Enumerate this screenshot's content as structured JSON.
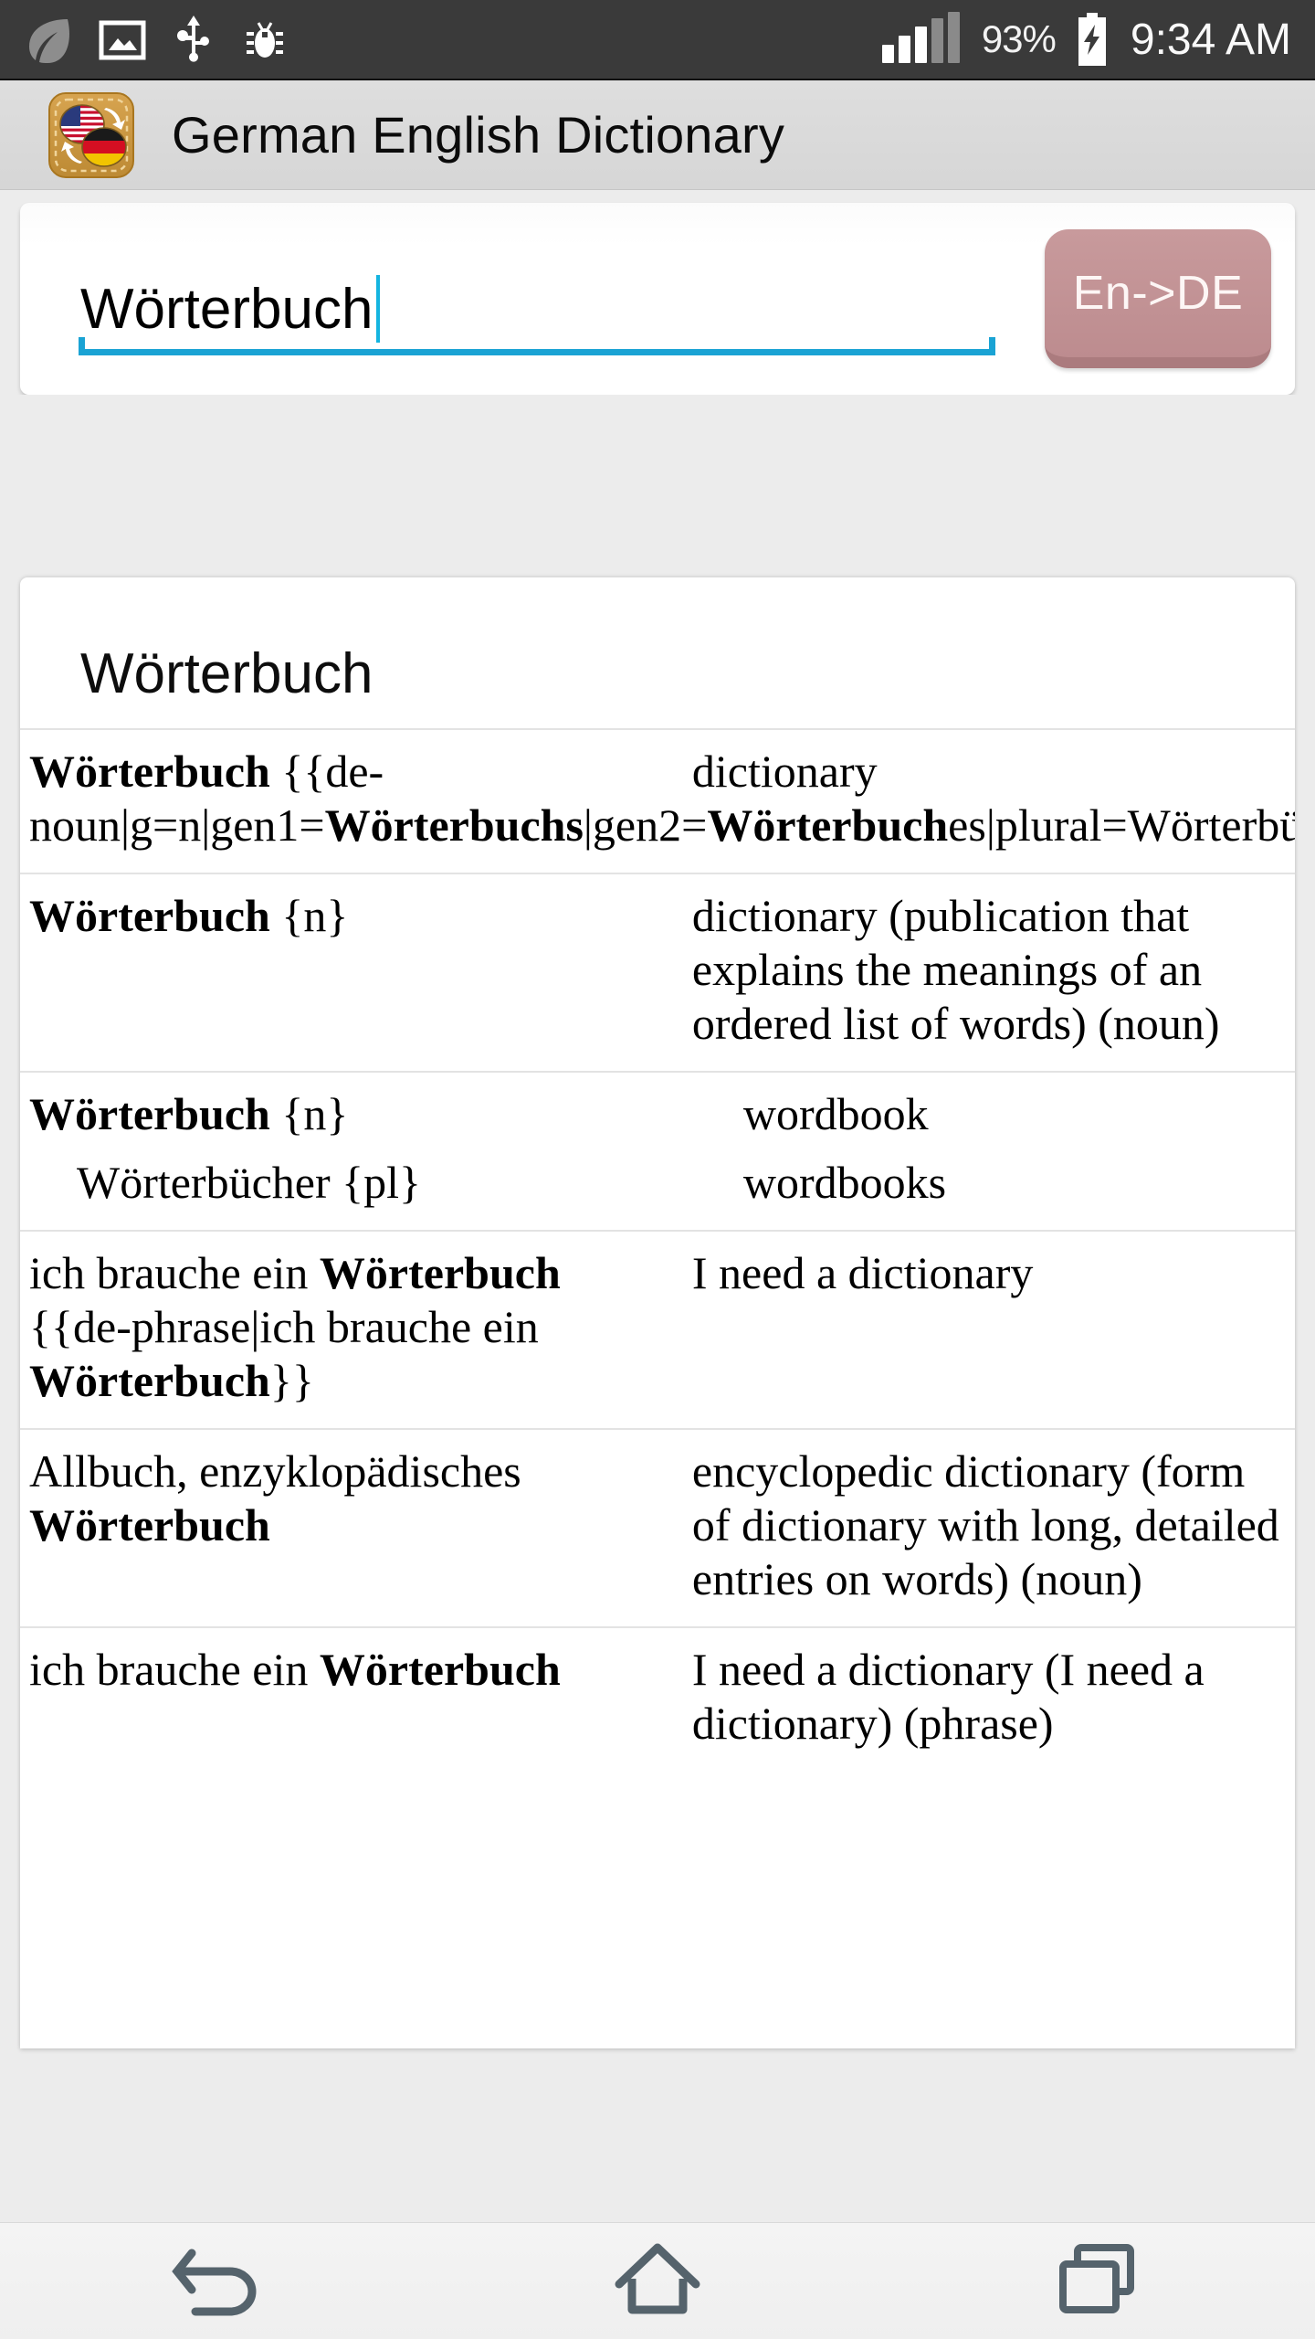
{
  "statusbar": {
    "icons": [
      "leaf-icon",
      "screenshot-icon",
      "usb-icon",
      "adb-bug-icon"
    ],
    "battery_percent": "93%",
    "battery_state": "charging",
    "signal_bars_active": 3,
    "signal_bars_total": 5,
    "clock": "9:34 AM"
  },
  "appbar": {
    "icon": "german-english-dictionary-app-icon",
    "title": "German English Dictionary"
  },
  "search": {
    "value": "Wörterbuch",
    "placeholder": "",
    "direction_button": "En->DE"
  },
  "results": {
    "heading": "Wörterbuch",
    "rows": [
      {
        "left_html": "<b>Wörterbuch</b> {{de-noun|g=n|gen1=<b>Wörterbuchs</b>|gen2=<b>Wörterbuch</b>es|plural=Wörterbücher}}",
        "left_text": "Wörterbuch {{de-noun|g=n|gen1=Wörterbuchs|gen2=Wörterbuches|plural=Wörterbücher}}",
        "right_html": "dictionary",
        "right_text": "dictionary",
        "right_indent": false,
        "sub_left_html": "",
        "sub_right_html": ""
      },
      {
        "left_html": "<b>Wörterbuch</b> {n}",
        "left_text": "Wörterbuch {n}",
        "right_html": "dictionary (publication that explains the meanings of an ordered list of words) (noun)",
        "right_text": "dictionary (publication that explains the meanings of an ordered list of words) (noun)",
        "right_indent": false,
        "sub_left_html": "",
        "sub_right_html": ""
      },
      {
        "left_html": "<b>Wörterbuch</b> {n}",
        "left_text": "Wörterbuch {n}",
        "right_html": "wordbook",
        "right_text": "wordbook",
        "right_indent": true,
        "sub_left_html": "Wörterbücher {pl}",
        "sub_right_html": "wordbooks"
      },
      {
        "left_html": "ich brauche ein <b>Wörterbuch</b> {{de-phrase|ich brauche ein <b>Wörterbuch</b>}}",
        "left_text": "ich brauche ein Wörterbuch {{de-phrase|ich brauche ein Wörterbuch}}",
        "right_html": "I need a dictionary",
        "right_text": "I need a dictionary",
        "right_indent": false,
        "sub_left_html": "",
        "sub_right_html": ""
      },
      {
        "left_html": "Allbuch, enzyklopädisches <b>Wörterbuch</b>",
        "left_text": "Allbuch, enzyklopädisches Wörterbuch",
        "right_html": "encyclopedic dictionary (form of dictionary with long, detailed entries on words) (noun)",
        "right_text": "encyclopedic dictionary (form of dictionary with long, detailed entries on words) (noun)",
        "right_indent": false,
        "sub_left_html": "",
        "sub_right_html": ""
      },
      {
        "left_html": "ich brauche ein <b>Wörterbuch</b>",
        "left_text": "ich brauche ein Wörterbuch",
        "right_html": "I need a dictionary (I need a dictionary) (phrase)",
        "right_text": "I need a dictionary (I need a dictionary) (phrase)",
        "right_indent": false,
        "sub_left_html": "",
        "sub_right_html": ""
      }
    ]
  },
  "navbar": {
    "buttons": [
      {
        "name": "back-icon",
        "label": "Back"
      },
      {
        "name": "home-icon",
        "label": "Home"
      },
      {
        "name": "recents-icon",
        "label": "Recent apps"
      }
    ]
  },
  "colors": {
    "statusbar_bg": "#3a3a3a",
    "appbar_bg": "#dcdcdc",
    "page_bg": "#ececec",
    "accent_underline": "#1aa3d4",
    "caret": "#13b4e0",
    "lang_button": "#c49396",
    "lang_button_shadow": "#ab7b7e",
    "nav_icon": "#55636c"
  }
}
